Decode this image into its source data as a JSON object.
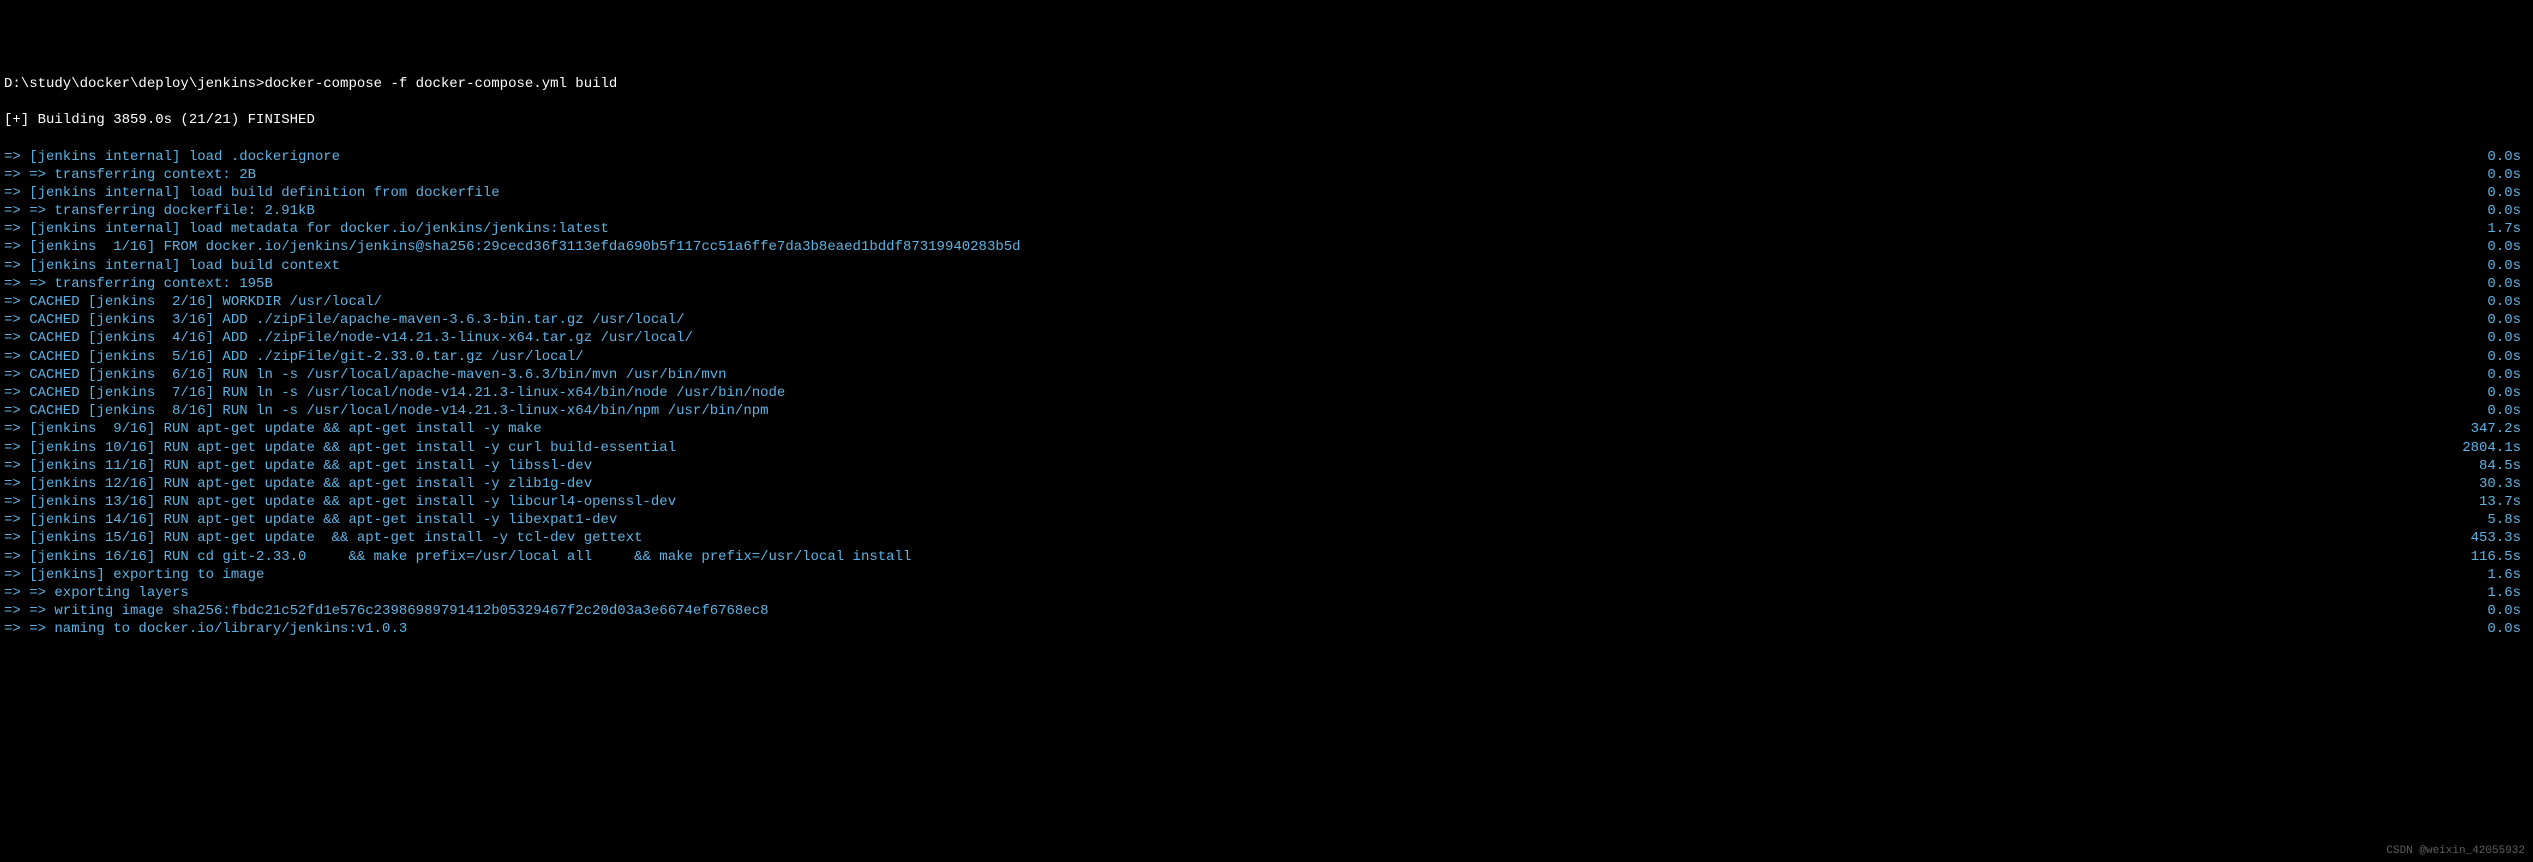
{
  "prompt": "D:\\study\\docker\\deploy\\jenkins>docker-compose -f docker-compose.yml build",
  "status": "[+] Building 3859.0s (21/21) FINISHED",
  "steps": [
    {
      "text": "=> [jenkins internal] load .dockerignore",
      "time": "0.0s"
    },
    {
      "text": "=> => transferring context: 2B",
      "time": "0.0s"
    },
    {
      "text": "=> [jenkins internal] load build definition from dockerfile",
      "time": "0.0s"
    },
    {
      "text": "=> => transferring dockerfile: 2.91kB",
      "time": "0.0s"
    },
    {
      "text": "=> [jenkins internal] load metadata for docker.io/jenkins/jenkins:latest",
      "time": "1.7s"
    },
    {
      "text": "=> [jenkins  1/16] FROM docker.io/jenkins/jenkins@sha256:29cecd36f3113efda690b5f117cc51a6ffe7da3b8eaed1bddf87319940283b5d",
      "time": "0.0s"
    },
    {
      "text": "=> [jenkins internal] load build context",
      "time": "0.0s"
    },
    {
      "text": "=> => transferring context: 195B",
      "time": "0.0s"
    },
    {
      "text": "=> CACHED [jenkins  2/16] WORKDIR /usr/local/",
      "time": "0.0s"
    },
    {
      "text": "=> CACHED [jenkins  3/16] ADD ./zipFile/apache-maven-3.6.3-bin.tar.gz /usr/local/",
      "time": "0.0s"
    },
    {
      "text": "=> CACHED [jenkins  4/16] ADD ./zipFile/node-v14.21.3-linux-x64.tar.gz /usr/local/",
      "time": "0.0s"
    },
    {
      "text": "=> CACHED [jenkins  5/16] ADD ./zipFile/git-2.33.0.tar.gz /usr/local/",
      "time": "0.0s"
    },
    {
      "text": "=> CACHED [jenkins  6/16] RUN ln -s /usr/local/apache-maven-3.6.3/bin/mvn /usr/bin/mvn",
      "time": "0.0s"
    },
    {
      "text": "=> CACHED [jenkins  7/16] RUN ln -s /usr/local/node-v14.21.3-linux-x64/bin/node /usr/bin/node",
      "time": "0.0s"
    },
    {
      "text": "=> CACHED [jenkins  8/16] RUN ln -s /usr/local/node-v14.21.3-linux-x64/bin/npm /usr/bin/npm",
      "time": "0.0s"
    },
    {
      "text": "=> [jenkins  9/16] RUN apt-get update && apt-get install -y make",
      "time": "347.2s"
    },
    {
      "text": "=> [jenkins 10/16] RUN apt-get update && apt-get install -y curl build-essential",
      "time": "2804.1s"
    },
    {
      "text": "=> [jenkins 11/16] RUN apt-get update && apt-get install -y libssl-dev",
      "time": "84.5s"
    },
    {
      "text": "=> [jenkins 12/16] RUN apt-get update && apt-get install -y zlib1g-dev",
      "time": "30.3s"
    },
    {
      "text": "=> [jenkins 13/16] RUN apt-get update && apt-get install -y libcurl4-openssl-dev",
      "time": "13.7s"
    },
    {
      "text": "=> [jenkins 14/16] RUN apt-get update && apt-get install -y libexpat1-dev",
      "time": "5.8s"
    },
    {
      "text": "=> [jenkins 15/16] RUN apt-get update  && apt-get install -y tcl-dev gettext",
      "time": "453.3s"
    },
    {
      "text": "=> [jenkins 16/16] RUN cd git-2.33.0     && make prefix=/usr/local all     && make prefix=/usr/local install",
      "time": "116.5s"
    },
    {
      "text": "=> [jenkins] exporting to image",
      "time": "1.6s"
    },
    {
      "text": "=> => exporting layers",
      "time": "1.6s"
    },
    {
      "text": "=> => writing image sha256:fbdc21c52fd1e576c23986989791412b05329467f2c20d03a3e6674ef6768ec8",
      "time": "0.0s"
    },
    {
      "text": "=> => naming to docker.io/library/jenkins:v1.0.3",
      "time": "0.0s"
    }
  ],
  "watermark": "CSDN @weixin_42055932"
}
